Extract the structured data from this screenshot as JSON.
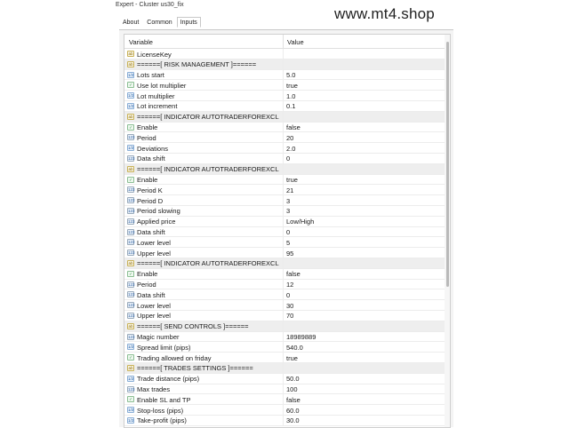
{
  "window": {
    "title": "Expert - Cluster us30_fix"
  },
  "watermark": "www.mt4.shop",
  "tabs": [
    {
      "label": "About",
      "active": false
    },
    {
      "label": "Common",
      "active": false
    },
    {
      "label": "Inputs",
      "active": true
    }
  ],
  "table": {
    "col_variable": "Variable",
    "col_value": "Value",
    "rows": [
      {
        "icon": "ab",
        "name": "LicenseKey",
        "value": "",
        "section": false
      },
      {
        "icon": "ab",
        "name": "======[ RISK MANAGEMENT ]======",
        "value": "",
        "section": true
      },
      {
        "icon": "dbl",
        "name": "Lots start",
        "value": "5.0",
        "section": false
      },
      {
        "icon": "bool",
        "name": "Use lot multiplier",
        "value": "true",
        "section": false
      },
      {
        "icon": "dbl",
        "name": "Lot multiplier",
        "value": "1.0",
        "section": false
      },
      {
        "icon": "dbl",
        "name": "Lot increment",
        "value": "0.1",
        "section": false
      },
      {
        "icon": "ab",
        "name": "======[ INDICATOR AUTOTRADERFOREXCLU...",
        "value": "",
        "section": true
      },
      {
        "icon": "bool",
        "name": "Enable",
        "value": "false",
        "section": false
      },
      {
        "icon": "int",
        "name": "Period",
        "value": "20",
        "section": false
      },
      {
        "icon": "dbl",
        "name": "Deviations",
        "value": "2.0",
        "section": false
      },
      {
        "icon": "int",
        "name": "Data shift",
        "value": "0",
        "section": false
      },
      {
        "icon": "ab",
        "name": "======[ INDICATOR AUTOTRADERFOREXCLU...",
        "value": "",
        "section": true
      },
      {
        "icon": "bool",
        "name": "Enable",
        "value": "true",
        "section": false
      },
      {
        "icon": "int",
        "name": "Period K",
        "value": "21",
        "section": false
      },
      {
        "icon": "int",
        "name": "Period D",
        "value": "3",
        "section": false
      },
      {
        "icon": "int",
        "name": "Period slowing",
        "value": "3",
        "section": false
      },
      {
        "icon": "int",
        "name": "Applied price",
        "value": "Low/High",
        "section": false
      },
      {
        "icon": "int",
        "name": "Data shift",
        "value": "0",
        "section": false
      },
      {
        "icon": "int",
        "name": "Lower level",
        "value": "5",
        "section": false
      },
      {
        "icon": "int",
        "name": "Upper level",
        "value": "95",
        "section": false
      },
      {
        "icon": "ab",
        "name": "======[ INDICATOR AUTOTRADERFOREXCLU...",
        "value": "",
        "section": true
      },
      {
        "icon": "bool",
        "name": "Enable",
        "value": "false",
        "section": false
      },
      {
        "icon": "int",
        "name": "Period",
        "value": "12",
        "section": false
      },
      {
        "icon": "int",
        "name": "Data shift",
        "value": "0",
        "section": false
      },
      {
        "icon": "int",
        "name": "Lower level",
        "value": "30",
        "section": false
      },
      {
        "icon": "int",
        "name": "Upper level",
        "value": "70",
        "section": false
      },
      {
        "icon": "ab",
        "name": "======[ SEND CONTROLS ]======",
        "value": "",
        "section": true
      },
      {
        "icon": "int",
        "name": "Magic number",
        "value": "18989889",
        "section": false
      },
      {
        "icon": "dbl",
        "name": "Spread limit (pips)",
        "value": "540.0",
        "section": false
      },
      {
        "icon": "bool",
        "name": "Trading allowed on friday",
        "value": "true",
        "section": false
      },
      {
        "icon": "ab",
        "name": "======[ TRADES SETTINGS ]======",
        "value": "",
        "section": true
      },
      {
        "icon": "dbl",
        "name": "Trade distance (pips)",
        "value": "50.0",
        "section": false
      },
      {
        "icon": "int",
        "name": "Max trades",
        "value": "100",
        "section": false
      },
      {
        "icon": "bool",
        "name": "Enable SL and TP",
        "value": "false",
        "section": false
      },
      {
        "icon": "dbl",
        "name": "Stop-loss (pips)",
        "value": "60.0",
        "section": false
      },
      {
        "icon": "dbl",
        "name": "Take-profit (pips)",
        "value": "30.0",
        "section": false
      }
    ]
  }
}
